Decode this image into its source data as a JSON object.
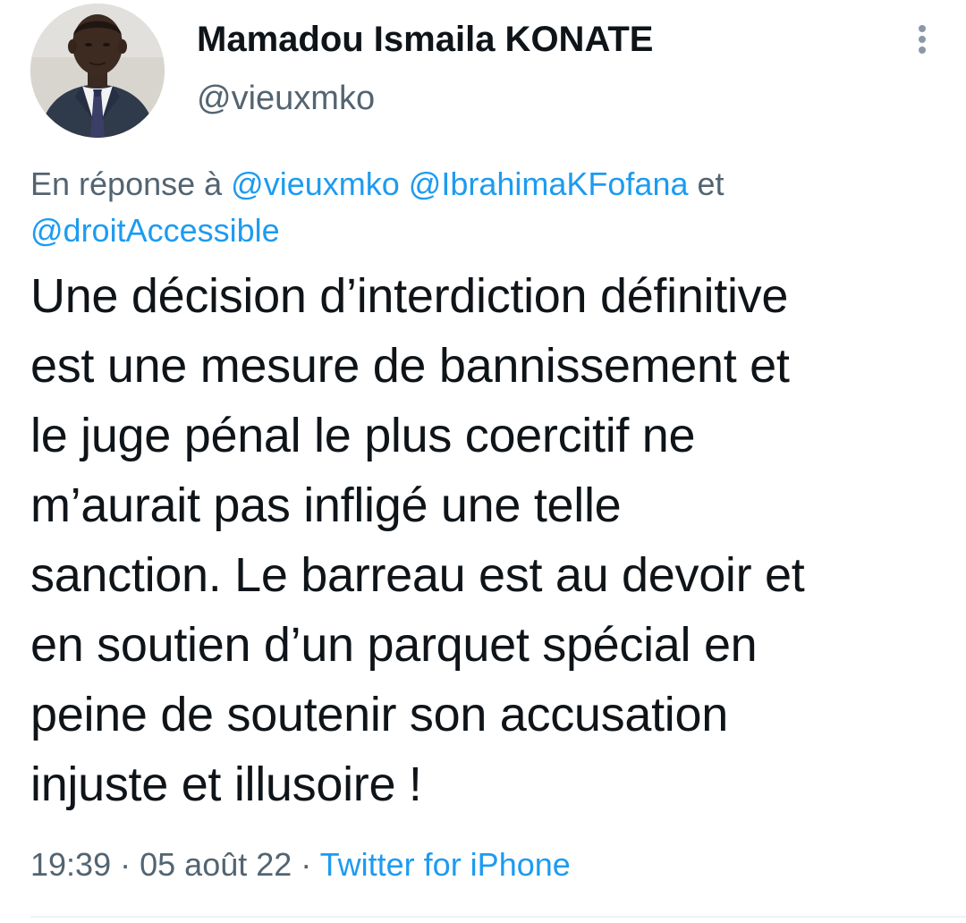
{
  "author": {
    "display_name": "Mamadou Ismaila KONATE",
    "handle": "@vieuxmko"
  },
  "reply_context": {
    "prefix": "En réponse à",
    "mentions": [
      "@vieuxmko",
      "@IbrahimaKFofana",
      "@droitAccessible"
    ],
    "conjunction": "et"
  },
  "tweet": {
    "text": "Une décision d’interdiction définitive\nest une mesure de bannissement et\nle juge pénal le plus coercitif ne\nm’aurait pas infligé une telle\nsanction. Le barreau est au devoir et\nen soutien d’un parquet spécial en\npeine de soutenir son accusation\ninjuste et illusoire !"
  },
  "meta": {
    "time": "19:39",
    "separator": "·",
    "date": "05 août 22",
    "source": "Twitter for iPhone"
  },
  "icons": {
    "more": "more-vertical-icon",
    "avatar": "profile-photo"
  },
  "colors": {
    "accent": "#1d9bf0",
    "secondary_text": "#536471",
    "primary_text": "#0f1419"
  }
}
